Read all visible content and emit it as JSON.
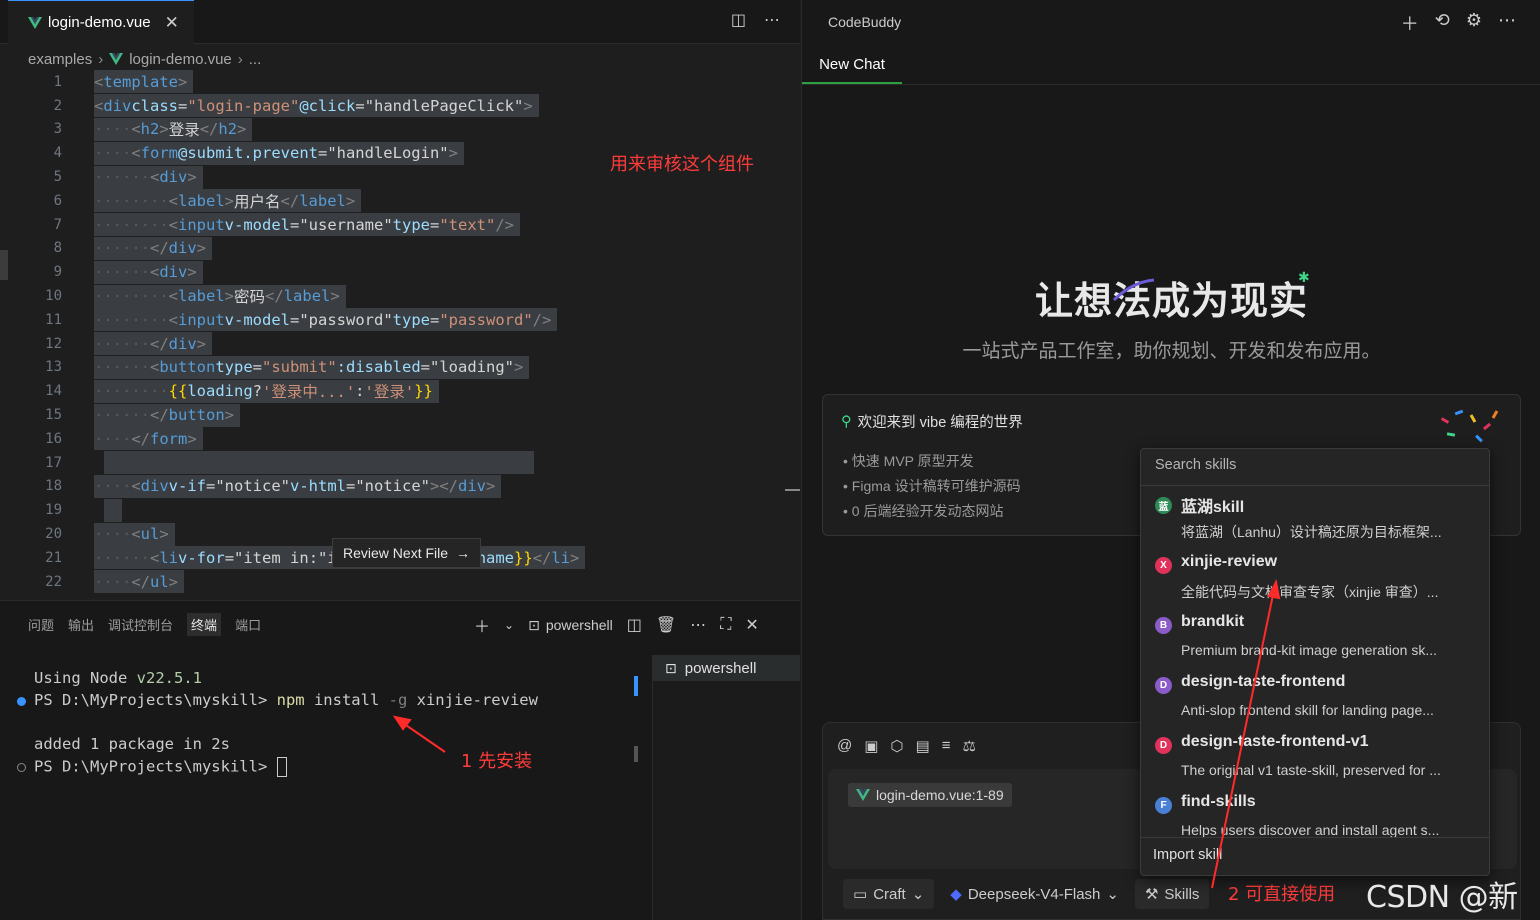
{
  "editor": {
    "tab_label": "login-demo.vue",
    "tab_close": "✕",
    "breadcrumb": [
      "examples",
      "login-demo.vue",
      "..."
    ],
    "annotation_review": "用来审核这个组件",
    "review_next_label": "Review Next File",
    "line_numbers": [
      "1",
      "2",
      "3",
      "4",
      "5",
      "6",
      "7",
      "8",
      "9",
      "10",
      "11",
      "12",
      "13",
      "14",
      "15",
      "16",
      "17",
      "18",
      "19",
      "20",
      "21",
      "22"
    ]
  },
  "panel": {
    "tabs": [
      "问题",
      "输出",
      "调试控制台",
      "终端",
      "端口"
    ],
    "active_tab": "终端",
    "shell_label": "powershell",
    "terminal_list_item": "powershell",
    "lines": {
      "l1_prefix": "Using Node ",
      "l1_version": "v22.5.1",
      "l2_prompt": "PS D:\\MyProjects\\myskill> ",
      "l2_cmd": "npm",
      "l2_install": " install ",
      "l2_flag": "-g",
      "l2_pkg": " xinjie-review",
      "l3": "added 1 package in 2s",
      "l4_prompt": "PS D:\\MyProjects\\myskill> "
    },
    "annotation_install": "1 先安装"
  },
  "codebuddy": {
    "title": "CodeBuddy",
    "tab": "New Chat",
    "hero_title": "让想法成为现实",
    "hero_subtitle": "一站式产品工作室，助你规划、开发和发布应用。",
    "welcome_title": "欢迎来到 vibe 编程的世界",
    "features": [
      "快速 MVP 原型开发",
      "Figma 设计稿转可维护源码",
      "0 后端经验开发动态网站"
    ],
    "context_chip": "login-demo.vue:1-89",
    "mode_button": "Craft",
    "model_button": "Deepseek-V4-Flash",
    "skills_button": "Skills",
    "annotation_use": "2 可直接使用",
    "skills_popup": {
      "search_placeholder": "Search skills",
      "items": [
        {
          "badge": "蓝",
          "color": "#2e8b57",
          "name": "蓝湖skill",
          "desc": "将蓝湖（Lanhu）设计稿还原为目标框架..."
        },
        {
          "badge": "X",
          "color": "#e0325a",
          "name": "xinjie-review",
          "desc": "全能代码与文档审查专家（xinjie 审查）..."
        },
        {
          "badge": "B",
          "color": "#8b5cc8",
          "name": "brandkit",
          "desc": "Premium brand-kit image generation sk..."
        },
        {
          "badge": "D",
          "color": "#8b5cc8",
          "name": "design-taste-frontend",
          "desc": "Anti-slop frontend skill for landing page..."
        },
        {
          "badge": "D",
          "color": "#e0325a",
          "name": "design-taste-frontend-v1",
          "desc": "The original v1 taste-skill, preserved for ..."
        },
        {
          "badge": "F",
          "color": "#4a7fd6",
          "name": "find-skills",
          "desc": "Helps users discover and install agent s..."
        }
      ],
      "import_label": "Import skill"
    }
  },
  "watermark": "CSDN @新节",
  "colors": {
    "accent_blue": "#3794ff",
    "tab_green": "#2ea043",
    "annotation_red": "#ff3b3b"
  },
  "icons": [
    "vue-icon",
    "split-editor-icon",
    "more-icon",
    "plus-icon",
    "history-icon",
    "gear-icon",
    "trash-icon",
    "maximize-icon",
    "close-icon",
    "terminal-icon",
    "at-icon",
    "image-icon",
    "figma-icon",
    "book-icon",
    "list-icon",
    "rules-icon",
    "award-icon",
    "skills-icon"
  ]
}
